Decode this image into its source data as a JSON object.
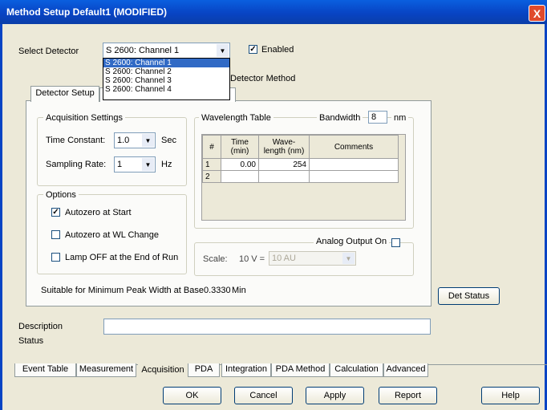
{
  "window": {
    "title": "Method Setup Default1 (MODIFIED)",
    "close_glyph": "X"
  },
  "detector": {
    "label": "Select Detector",
    "selected": "S 2600: Channel 1",
    "options": [
      "S 2600: Channel 1",
      "S 2600: Channel 2",
      "S 2600: Channel 3",
      "S 2600: Channel 4"
    ],
    "enabled_label": "Enabled",
    "enabled_checked": "✓"
  },
  "tabs": {
    "detector_setup": "Detector Setup",
    "detector_method_partial": "Detector Method"
  },
  "acquisition": {
    "legend": "Acquisition Settings",
    "time_constant_label": "Time Constant:",
    "time_constant_value": "1.0",
    "time_constant_unit": "Sec",
    "sampling_rate_label": "Sampling Rate:",
    "sampling_rate_value": "1",
    "sampling_rate_unit": "Hz"
  },
  "options": {
    "legend": "Options",
    "autozero_start": "Autozero at Start",
    "autozero_start_checked": "✓",
    "autozero_wl": "Autozero at WL Change",
    "lamp_off": "Lamp OFF at the End of Run"
  },
  "wavelength": {
    "legend": "Wavelength Table",
    "bandwidth_label": "Bandwidth",
    "bandwidth_value": "8",
    "bandwidth_unit": "nm",
    "headers": {
      "num": "#",
      "time": "Time (min)",
      "wave": "Wave- length (nm)",
      "comments": "Comments"
    },
    "rows": [
      {
        "num": "1",
        "time": "0.00",
        "wave": "254",
        "comments": ""
      },
      {
        "num": "2",
        "time": "",
        "wave": "",
        "comments": ""
      }
    ]
  },
  "analog": {
    "label": "Analog Output On",
    "scale_label": "Scale:",
    "scale_prefix": "10 V =",
    "scale_value": "10 AU"
  },
  "min_peak": {
    "label": "Suitable for Minimum Peak Width at Base",
    "value": "0.3330",
    "unit": "Min"
  },
  "det_status_button": "Det Status",
  "description_label": "Description",
  "status_label": "Status",
  "bottom_tabs": [
    "Event Table",
    "Measurement",
    "Acquisition",
    "PDA",
    "Integration",
    "PDA Method",
    "Calculation",
    "Advanced"
  ],
  "buttons": {
    "ok": "OK",
    "cancel": "Cancel",
    "apply": "Apply",
    "report": "Report",
    "help": "Help"
  },
  "colors": {
    "title_bar": "#0a5fdf",
    "selection": "#316ac5",
    "window_bg": "#ece9d8"
  }
}
